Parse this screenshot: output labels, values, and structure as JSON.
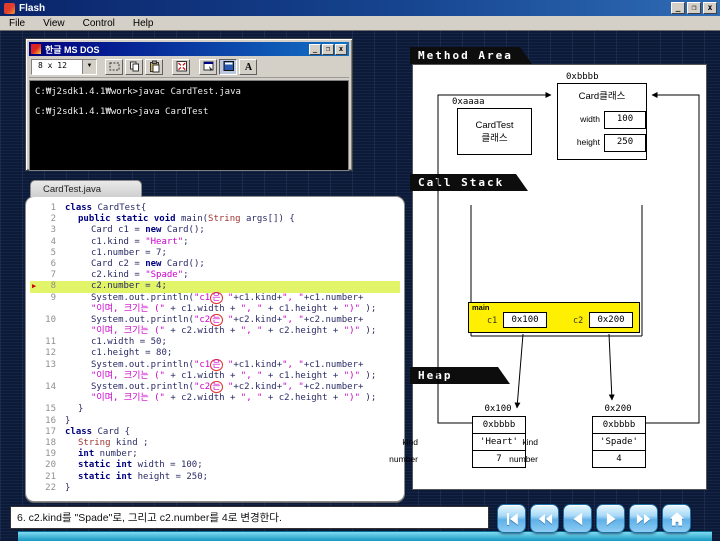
{
  "window": {
    "title": "Flash",
    "controls": {
      "minimize": "_",
      "maximize": "❐",
      "close": "x"
    }
  },
  "menu": {
    "items": [
      "File",
      "View",
      "Control",
      "Help"
    ]
  },
  "dos_window": {
    "title": "한글 MS DOS",
    "controls": {
      "minimize": "_",
      "restore": "❐",
      "close": "x"
    },
    "font_size": "8 x 12",
    "toolbar_buttons": [
      {
        "name": "marquee-select"
      },
      {
        "name": "copy"
      },
      {
        "name": "paste"
      },
      {
        "name": "fullscreen"
      },
      {
        "name": "properties"
      },
      {
        "name": "background",
        "pressed": true
      },
      {
        "name": "font"
      }
    ],
    "console_lines": [
      "C:₩j2sdk1.4.1₩work>javac CardTest.java",
      "C:₩j2sdk1.4.1₩work>java CardTest"
    ]
  },
  "code_window": {
    "tab": "CardTest.java",
    "lines": [
      {
        "n": "1",
        "ind": 0,
        "parts": [
          [
            "kw",
            "class "
          ],
          [
            "pl",
            "CardTest{"
          ]
        ]
      },
      {
        "n": "2",
        "ind": 1,
        "parts": [
          [
            "kw",
            "public static void "
          ],
          [
            "pl",
            "main("
          ],
          [
            "ty",
            "String"
          ],
          [
            "pl",
            " args[]) {"
          ]
        ]
      },
      {
        "n": "3",
        "ind": 2,
        "parts": [
          [
            "pl",
            "Card c1 = "
          ],
          [
            "kw",
            "new"
          ],
          [
            "pl",
            " Card();"
          ]
        ]
      },
      {
        "n": "4",
        "ind": 2,
        "parts": [
          [
            "pl",
            "c1.kind = "
          ],
          [
            "st",
            "\"Heart\""
          ],
          [
            "pl",
            ";"
          ]
        ]
      },
      {
        "n": "5",
        "ind": 2,
        "parts": [
          [
            "pl",
            "c1.number = 7;"
          ]
        ]
      },
      {
        "n": "6",
        "ind": 2,
        "parts": [
          [
            "pl",
            "Card c2 = "
          ],
          [
            "kw",
            "new"
          ],
          [
            "pl",
            " Card();"
          ]
        ]
      },
      {
        "n": "7",
        "ind": 2,
        "parts": [
          [
            "pl",
            "c2.kind = "
          ],
          [
            "st",
            "\"Spade\""
          ],
          [
            "pl",
            ";"
          ]
        ]
      },
      {
        "n": "8",
        "ind": 2,
        "hl": true,
        "parts": [
          [
            "pl",
            "c2.number = 4;"
          ]
        ]
      },
      {
        "n": "9",
        "ind": 2,
        "parts": [
          [
            "pl",
            "System.out.println("
          ],
          [
            "st",
            "\"c1"
          ],
          [
            "cir",
            "은"
          ],
          [
            "st",
            " \""
          ],
          [
            "pl",
            "+c1.kind+"
          ],
          [
            "st",
            "\", \""
          ],
          [
            "pl",
            "+c1.number+"
          ]
        ]
      },
      {
        "n": "",
        "ind": 2,
        "parts": [
          [
            "st",
            "\"이며, 크기는 (\""
          ],
          [
            "pl",
            " + c1.width + "
          ],
          [
            "st",
            "\", \""
          ],
          [
            "pl",
            " + c1.height + "
          ],
          [
            "st",
            "\")\""
          ],
          [
            "pl",
            " );"
          ]
        ]
      },
      {
        "n": "10",
        "ind": 2,
        "parts": [
          [
            "pl",
            "System.out.println("
          ],
          [
            "st",
            "\"c2"
          ],
          [
            "cir",
            "는"
          ],
          [
            "st",
            " \""
          ],
          [
            "pl",
            "+c2.kind+"
          ],
          [
            "st",
            "\", \""
          ],
          [
            "pl",
            "+c2.number+"
          ]
        ]
      },
      {
        "n": "",
        "ind": 2,
        "parts": [
          [
            "st",
            "\"이며, 크기는 (\""
          ],
          [
            "pl",
            " + c2.width + "
          ],
          [
            "st",
            "\", \""
          ],
          [
            "pl",
            " + c2.height + "
          ],
          [
            "st",
            "\")\""
          ],
          [
            "pl",
            " );"
          ]
        ]
      },
      {
        "n": "11",
        "ind": 2,
        "parts": [
          [
            "pl",
            "c1.width = 50;"
          ]
        ]
      },
      {
        "n": "12",
        "ind": 2,
        "parts": [
          [
            "pl",
            "c1.height = 80;"
          ]
        ]
      },
      {
        "n": "13",
        "ind": 2,
        "parts": [
          [
            "pl",
            "System.out.println("
          ],
          [
            "st",
            "\"c1"
          ],
          [
            "cir",
            "은"
          ],
          [
            "st",
            " \""
          ],
          [
            "pl",
            "+c1.kind+"
          ],
          [
            "st",
            "\", \""
          ],
          [
            "pl",
            "+c1.number+"
          ]
        ]
      },
      {
        "n": "",
        "ind": 2,
        "parts": [
          [
            "st",
            "\"이며, 크기는 (\""
          ],
          [
            "pl",
            " + c1.width + "
          ],
          [
            "st",
            "\", \""
          ],
          [
            "pl",
            " + c1.height + "
          ],
          [
            "st",
            "\")\""
          ],
          [
            "pl",
            " );"
          ]
        ]
      },
      {
        "n": "14",
        "ind": 2,
        "parts": [
          [
            "pl",
            "System.out.println("
          ],
          [
            "st",
            "\"c2"
          ],
          [
            "cir",
            "는"
          ],
          [
            "st",
            " \""
          ],
          [
            "pl",
            "+c2.kind+"
          ],
          [
            "st",
            "\", \""
          ],
          [
            "pl",
            "+c2.number+"
          ]
        ]
      },
      {
        "n": "",
        "ind": 2,
        "parts": [
          [
            "st",
            "\"이며, 크기는 (\""
          ],
          [
            "pl",
            " + c2.width + "
          ],
          [
            "st",
            "\", \""
          ],
          [
            "pl",
            " + c2.height + "
          ],
          [
            "st",
            "\")\""
          ],
          [
            "pl",
            " );"
          ]
        ]
      },
      {
        "n": "15",
        "ind": 1,
        "parts": [
          [
            "pl",
            "}"
          ]
        ]
      },
      {
        "n": "16",
        "ind": 0,
        "parts": [
          [
            "pl",
            "}"
          ]
        ]
      },
      {
        "n": "17",
        "ind": 0,
        "parts": [
          [
            "kw",
            "class "
          ],
          [
            "pl",
            "Card {"
          ]
        ]
      },
      {
        "n": "18",
        "ind": 1,
        "parts": [
          [
            "ty",
            "String"
          ],
          [
            "pl",
            " kind ;"
          ]
        ]
      },
      {
        "n": "19",
        "ind": 1,
        "parts": [
          [
            "kw",
            "int"
          ],
          [
            "pl",
            " number;"
          ]
        ]
      },
      {
        "n": "20",
        "ind": 1,
        "parts": [
          [
            "kw",
            "static int"
          ],
          [
            "pl",
            " width = 100;"
          ]
        ]
      },
      {
        "n": "21",
        "ind": 1,
        "parts": [
          [
            "kw",
            "static int"
          ],
          [
            "pl",
            " height = 250;"
          ]
        ]
      },
      {
        "n": "22",
        "ind": 0,
        "parts": [
          [
            "pl",
            "}"
          ]
        ]
      }
    ]
  },
  "memory": {
    "method_area": {
      "title": "Method Area",
      "cardtest": {
        "addr": "0xaaaa",
        "label_line1": "CardTest",
        "label_line2": "클래스"
      },
      "card": {
        "addr": "0xbbbb",
        "label": "Card클래스",
        "fields": [
          {
            "name": "width",
            "value": "100"
          },
          {
            "name": "height",
            "value": "250"
          }
        ]
      }
    },
    "call_stack": {
      "title": "Call Stack",
      "frame": {
        "name": "main",
        "vars": [
          {
            "name": "c1",
            "value": "0x100"
          },
          {
            "name": "c2",
            "value": "0x200"
          }
        ]
      }
    },
    "heap": {
      "title": "Heap",
      "objects": [
        {
          "addr": "0x100",
          "class_ref": "0xbbbb",
          "fields": [
            {
              "name": "kind",
              "value": "'Heart'"
            },
            {
              "name": "number",
              "value": "7"
            }
          ]
        },
        {
          "addr": "0x200",
          "class_ref": "0xbbbb",
          "fields": [
            {
              "name": "kind",
              "value": "'Spade'"
            },
            {
              "name": "number",
              "value": "4"
            }
          ]
        }
      ]
    }
  },
  "footer": {
    "status": "6. c2.kind를 \"Spade\"로, 그리고 c2.number를 4로 변경한다.",
    "nav_buttons": [
      {
        "name": "first"
      },
      {
        "name": "rewind"
      },
      {
        "name": "previous"
      },
      {
        "name": "play"
      },
      {
        "name": "forward"
      },
      {
        "name": "home"
      }
    ]
  }
}
